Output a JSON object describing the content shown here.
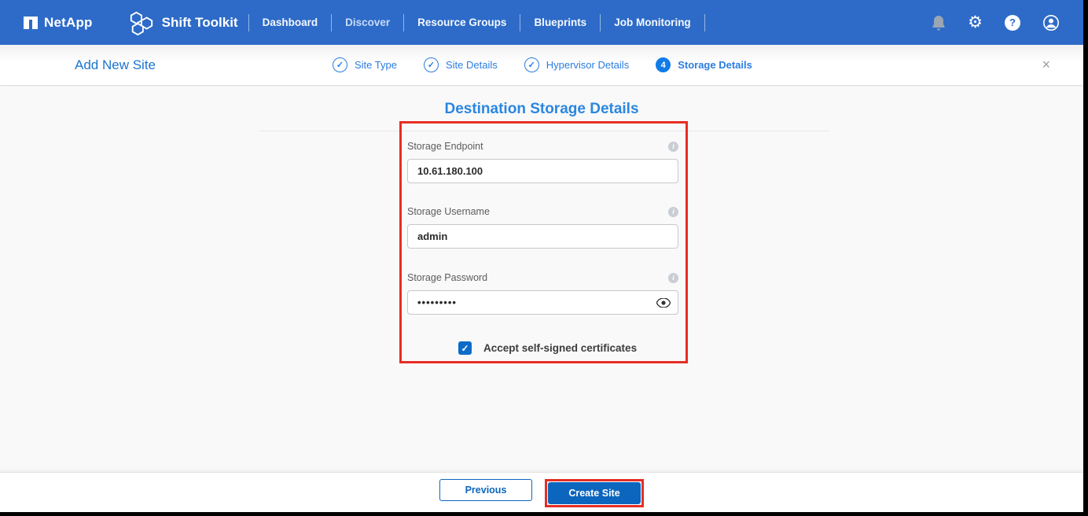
{
  "colors": {
    "navbar": "#2e6bc8",
    "step_blue": "#2a7de0",
    "title_blue": "#2b86e0",
    "button_blue": "#0d66bd",
    "checkbox_blue": "#0d6cc8",
    "annotation_red": "#e62e24"
  },
  "brand": {
    "company": "NetApp",
    "product": "Shift Toolkit"
  },
  "nav": {
    "items": [
      "Dashboard",
      "Discover",
      "Resource Groups",
      "Blueprints",
      "Job Monitoring"
    ]
  },
  "icons": {
    "check": "✓",
    "close": "×",
    "help": "?",
    "gear": "⚙"
  },
  "wizard": {
    "title": "Add New Site",
    "steps": [
      {
        "label": "Site Type",
        "state": "done"
      },
      {
        "label": "Site Details",
        "state": "done"
      },
      {
        "label": "Hypervisor Details",
        "state": "done"
      },
      {
        "label": "Storage Details",
        "state": "active",
        "number": "4"
      }
    ]
  },
  "main": {
    "title": "Destination Storage Details",
    "fields": [
      {
        "label": "Storage Endpoint",
        "value": "10.61.180.100"
      },
      {
        "label": "Storage Username",
        "value": "admin"
      },
      {
        "label": "Storage Password",
        "masked_value": "•••••••••"
      }
    ],
    "checkbox": {
      "label": "Accept self-signed certificates",
      "checked": true
    }
  },
  "footer": {
    "previous_label": "Previous",
    "create_label": "Create Site"
  }
}
